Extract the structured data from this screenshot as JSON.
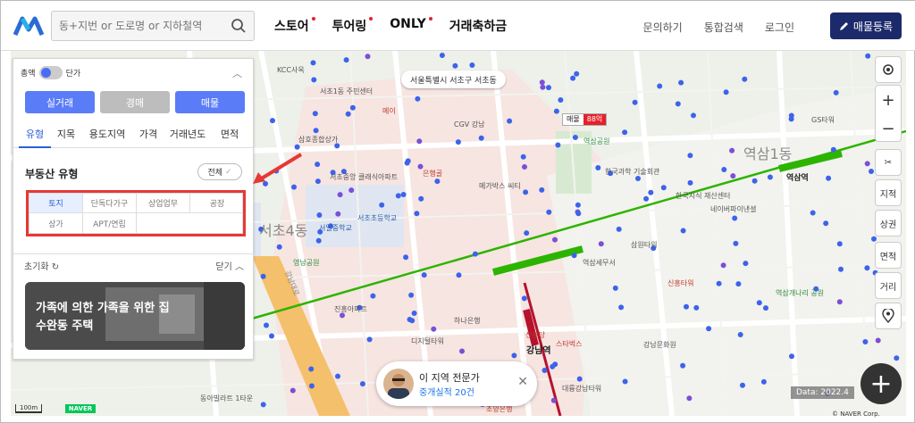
{
  "header": {
    "search_placeholder": "동+지번 or 도로명 or 지하철역",
    "nav": [
      {
        "label": "스토어",
        "dot": true
      },
      {
        "label": "투어링",
        "dot": true
      },
      {
        "label": "ONLY",
        "dot": true
      },
      {
        "label": "거래축하금",
        "dot": false
      }
    ],
    "links": [
      "문의하기",
      "통합검색",
      "로그인"
    ],
    "register_label": "매물등록"
  },
  "panel": {
    "toggle_left": "총액",
    "toggle_right": "단가",
    "buttons": [
      "실거래",
      "경매",
      "매물"
    ],
    "tabs": [
      "유형",
      "지목",
      "용도지역",
      "가격",
      "거래년도",
      "면적"
    ],
    "section_title": "부동산 유형",
    "all_label": "전체",
    "types_row1": [
      "토지",
      "단독다가구",
      "상업업무",
      "공장"
    ],
    "types_row2": [
      "상가",
      "APT/연립"
    ],
    "reset_label": "초기화",
    "close_label": "닫기",
    "ad_text_line1": "가족에 의한 가족을 위한 집",
    "ad_text_line2": "수완동 주택"
  },
  "map": {
    "location_chip": "서울특별시 서초구 서초동",
    "price_tag_label": "매물",
    "price_tag_value": "88억",
    "labels": [
      {
        "text": "KCC사옥",
        "c": "#555"
      },
      {
        "text": "서초1동\n주민센터",
        "c": "#555"
      },
      {
        "text": "삼호종합상가",
        "c": "#555"
      },
      {
        "text": "서초중앙\n클래식아파트",
        "c": "#555"
      },
      {
        "text": "서초초등학교",
        "c": "#2a5caa"
      },
      {
        "text": "서일중학교",
        "c": "#2a5caa"
      },
      {
        "text": "영남공원",
        "c": "#2e8b3e"
      },
      {
        "text": "진흥아파트",
        "c": "#555"
      },
      {
        "text": "CGV 강남",
        "c": "#555"
      },
      {
        "text": "메이",
        "c": "#c0392b"
      },
      {
        "text": "은행골",
        "c": "#c0392b"
      },
      {
        "text": "메가박스\n씨티",
        "c": "#555"
      },
      {
        "text": "역삼공원",
        "c": "#2e8b3e"
      },
      {
        "text": "한국과학\n기술회관",
        "c": "#555"
      },
      {
        "text": "한국지식\n재산센터",
        "c": "#555"
      },
      {
        "text": "네이버파이낸셜",
        "c": "#555"
      },
      {
        "text": "역삼1동",
        "c": "#8a8a8a"
      },
      {
        "text": "역삼역",
        "c": "#222"
      },
      {
        "text": "삼원타워",
        "c": "#555"
      },
      {
        "text": "역삼세무서",
        "c": "#555"
      },
      {
        "text": "신흥타워",
        "c": "#c0392b"
      },
      {
        "text": "강남역",
        "c": "#222"
      },
      {
        "text": "신분당",
        "c": "#c0392b"
      },
      {
        "text": "하나은행",
        "c": "#555"
      },
      {
        "text": "디지털타워",
        "c": "#555"
      },
      {
        "text": "스타벅스",
        "c": "#c0392b"
      },
      {
        "text": "강남문화원",
        "c": "#555"
      },
      {
        "text": "역삼개나리\n공원",
        "c": "#2e8b3e"
      },
      {
        "text": "대륭강남타워",
        "c": "#555"
      },
      {
        "text": "동아빌라트\n1타운",
        "c": "#555"
      },
      {
        "text": "조양은행",
        "c": "#c0392b"
      },
      {
        "text": "GS타워",
        "c": "#555"
      },
      {
        "text": "서초4동",
        "c": "#8a8a8a"
      },
      {
        "text": "강남대로",
        "c": "#888"
      }
    ]
  },
  "tools": {
    "buttons": [
      "지적",
      "상권",
      "면적",
      "거리"
    ]
  },
  "expert": {
    "title": "이 지역 전문가",
    "subtitle": "중개실적 20건"
  },
  "footer": {
    "scale": "100m",
    "naver": "NAVER",
    "data_label": "Data: 2022.4",
    "copyright": "© NAVER Corp."
  },
  "colors": {
    "accent_blue": "#4a6cf7",
    "button_active": "#5b7cf7",
    "button_inactive": "#bdbdbd",
    "register_bg": "#1c2a6b",
    "subway_line2": "#2db400",
    "subway_sinbundang": "#b5122e",
    "highlight_red": "#e53935"
  },
  "icons": [
    "logo-icon",
    "search-icon",
    "pencil-icon",
    "chevron-up-icon",
    "check-icon",
    "reset-icon",
    "gps-icon",
    "plus-icon",
    "minus-icon",
    "tool-icon",
    "location-pin-icon",
    "close-icon",
    "add-icon"
  ]
}
